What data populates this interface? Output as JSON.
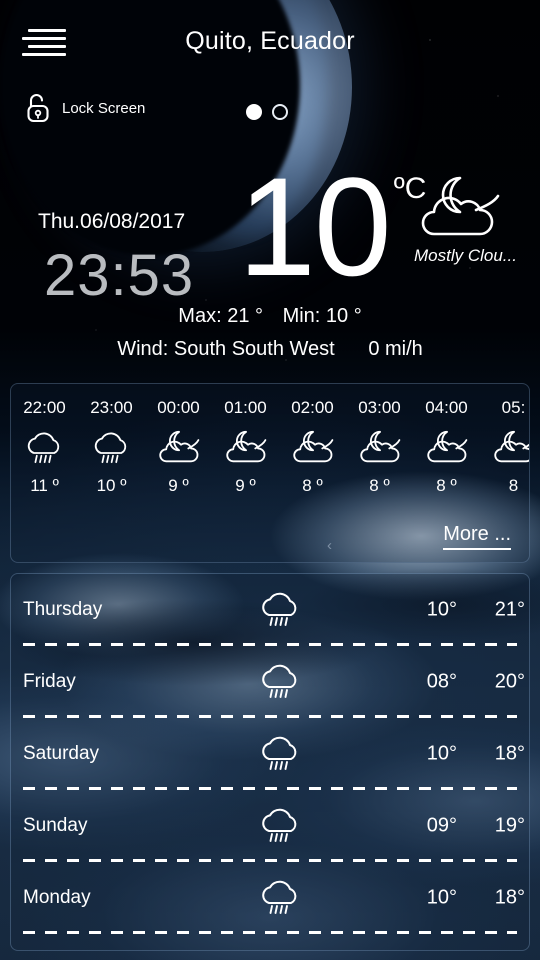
{
  "header": {
    "title": "Quito, Ecuador",
    "menu_icon": "hamburger-menu-icon",
    "lock": {
      "label": "Lock Screen",
      "icon": "unlock-icon"
    },
    "pager": {
      "total": 2,
      "active_index": 0
    }
  },
  "current": {
    "date": "Thu.06/08/2017",
    "time": "23:53",
    "temperature": "10",
    "unit": "ºC",
    "condition": "Mostly Clou...",
    "condition_icon": "moon-cloud-icon",
    "max_label": "Max: 21 °",
    "min_label": "Min: 10 °",
    "wind_label": "Wind: South South West",
    "wind_speed": "0 mi/h"
  },
  "hourly": {
    "more_label": "More ...",
    "prev_arrow": "‹",
    "items": [
      {
        "time": "22:00",
        "icon": "rain-cloud-icon",
        "temp": "11 º"
      },
      {
        "time": "23:00",
        "icon": "rain-cloud-icon",
        "temp": "10 º"
      },
      {
        "time": "00:00",
        "icon": "moon-cloud-icon",
        "temp": "9 º"
      },
      {
        "time": "01:00",
        "icon": "moon-cloud-icon",
        "temp": "9 º"
      },
      {
        "time": "02:00",
        "icon": "moon-cloud-icon",
        "temp": "8 º"
      },
      {
        "time": "03:00",
        "icon": "moon-cloud-icon",
        "temp": "8 º"
      },
      {
        "time": "04:00",
        "icon": "moon-cloud-icon",
        "temp": "8 º"
      },
      {
        "time": "05:",
        "icon": "moon-cloud-icon",
        "temp": "8"
      }
    ]
  },
  "daily": {
    "items": [
      {
        "day": "Thursday",
        "icon": "rain-cloud-icon",
        "low": "10°",
        "high": "21°"
      },
      {
        "day": "Friday",
        "icon": "rain-cloud-icon",
        "low": "08°",
        "high": "20°"
      },
      {
        "day": "Saturday",
        "icon": "rain-cloud-icon",
        "low": "10°",
        "high": "18°"
      },
      {
        "day": "Sunday",
        "icon": "rain-cloud-icon",
        "low": "09°",
        "high": "19°"
      },
      {
        "day": "Monday",
        "icon": "rain-cloud-icon",
        "low": "10°",
        "high": "18°"
      }
    ]
  },
  "colors": {
    "text": "#ffffff",
    "clock": "#b9bcc0",
    "card_border": "#96b9e1",
    "background_top": "#000103",
    "background_bottom": "#16293c"
  }
}
